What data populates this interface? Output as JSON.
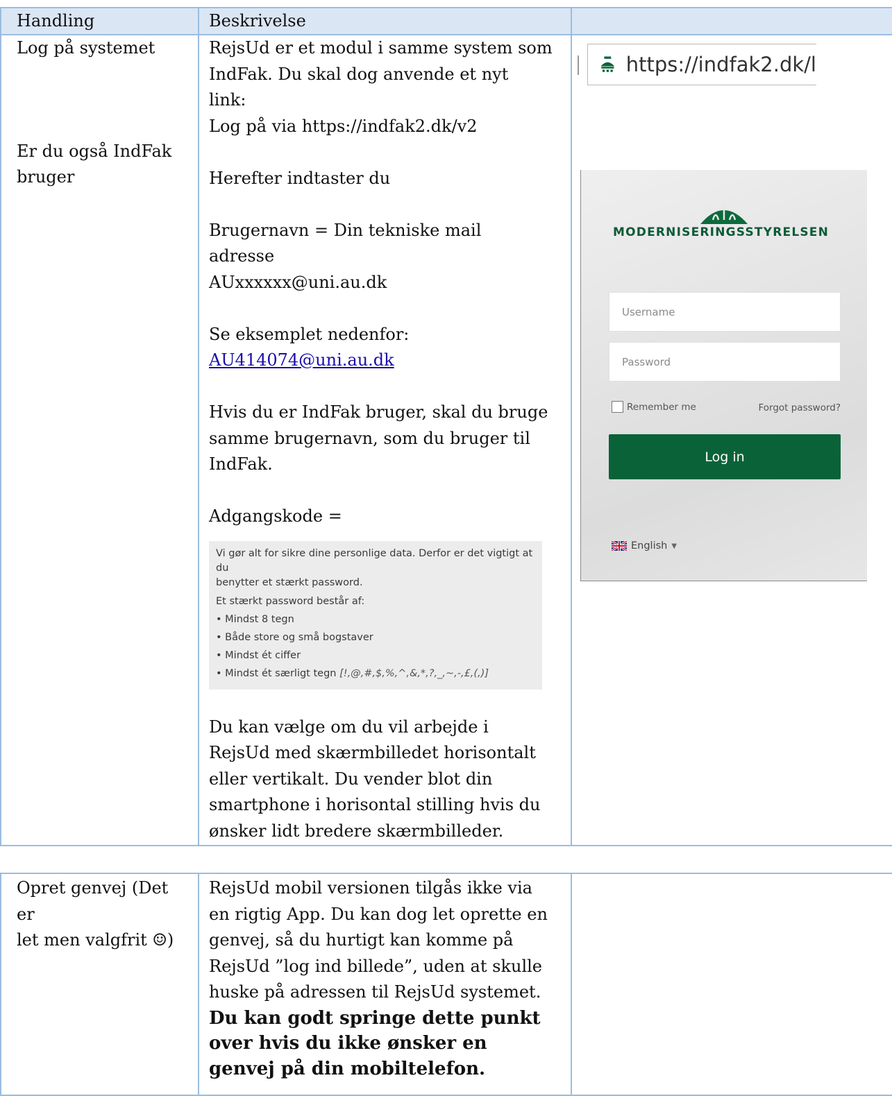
{
  "table1": {
    "headers": [
      "Handling",
      "Beskrivelse",
      ""
    ],
    "col1": {
      "line1": "Log på systemet",
      "line2": "Er du også IndFak",
      "line3": "bruger"
    },
    "col2": {
      "p1": [
        "RejsUd er et modul i samme system som",
        "IndFak. Du skal dog anvende et nyt",
        "link:",
        "Log på via https://indfak2.dk/v2"
      ],
      "p2": "Herefter indtaster du",
      "p3": [
        "Brugernavn = Din tekniske mail",
        "adresse",
        "AUxxxxxx@uni.au.dk"
      ],
      "p4_line1": "Se eksemplet nedenfor:",
      "p4_link": "AU414074@uni.au.dk",
      "p5": [
        "Hvis du er IndFak bruger, skal du bruge",
        "samme brugernavn, som du bruger til",
        "IndFak."
      ],
      "p6": "Adgangskode =",
      "password_box": {
        "intro1": "Vi gør alt for sikre dine personlige data. Derfor er det vigtigt at du",
        "intro2": "benytter et stærkt password.",
        "intro3": "Et stærkt password består af:",
        "rules": [
          "• Mindst 8 tegn",
          "• Både store og små bogstaver",
          "• Mindst ét ciffer",
          "• Mindst ét særligt tegn"
        ],
        "special_chars": "[!,@,#,$,%,^,&,*,?,_,~,-,£,(,)]"
      },
      "p7": [
        "Du kan vælge om du vil arbejde i",
        "RejsUd med skærmbilledet horisontalt",
        "eller vertikalt. Du vender blot din",
        "smartphone i horisontal stilling hvis du",
        "ønsker lidt bredere skærmbilleder."
      ]
    }
  },
  "url_bar": {
    "text": "https://indfak2.dk/l"
  },
  "login_panel": {
    "brand": "MODERNISERINGSSTYRELSEN",
    "username_placeholder": "Username",
    "password_placeholder": "Password",
    "remember_label": "Remember me",
    "forgot_label": "Forgot password?",
    "login_button": "Log in",
    "language": "English",
    "brand_color": "#0a6338"
  },
  "table2": {
    "col1": [
      "Opret genvej (Det er",
      "let men valgfrit ☺)"
    ],
    "col2": [
      "RejsUd mobil versionen tilgås ikke via",
      "en rigtig App. Du kan dog let oprette en",
      "genvej, så du hurtigt kan komme på",
      "RejsUd ”log ind billede”, uden at skulle",
      "huske på adressen til RejsUd systemet."
    ],
    "col2_bold": [
      "Du kan godt springe dette punkt",
      "over hvis du ikke ønsker en",
      "genvej på din mobiltelefon."
    ]
  }
}
